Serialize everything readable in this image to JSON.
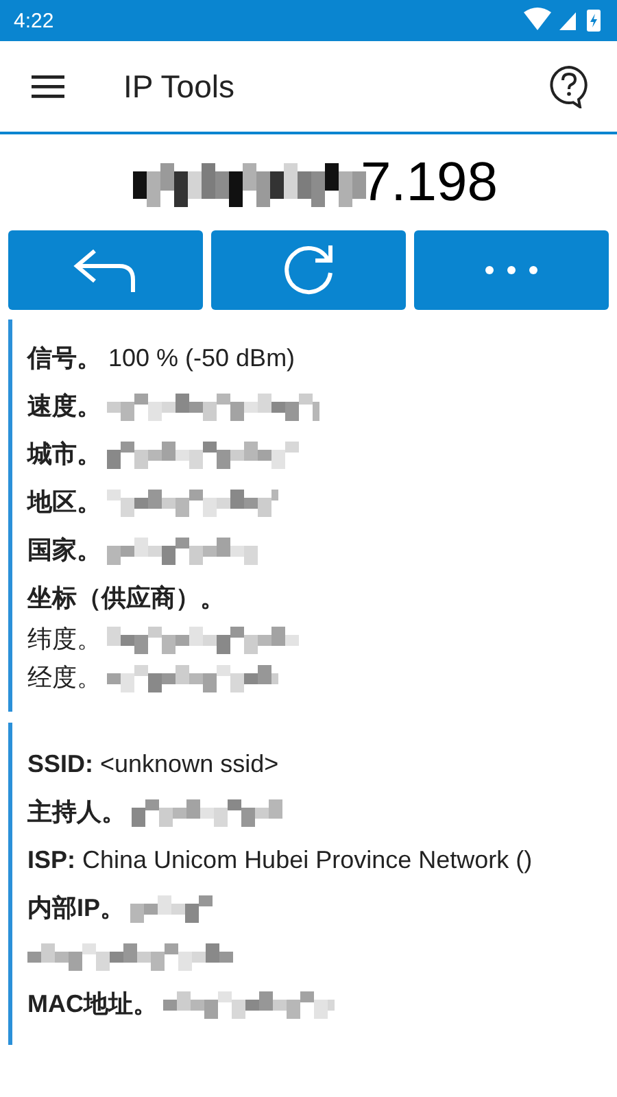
{
  "status_bar": {
    "time": "4:22"
  },
  "app_bar": {
    "title": "IP Tools"
  },
  "ip": {
    "visible_part": "7.198"
  },
  "buttons": [
    {
      "kind": "back"
    },
    {
      "kind": "refresh"
    },
    {
      "kind": "more"
    }
  ],
  "sections": [
    {
      "rows": [
        {
          "kind": "label_value",
          "label": "信号。",
          "value": "100 % (-50 dBm)"
        },
        {
          "kind": "label_blurred",
          "label": "速度。"
        },
        {
          "kind": "label_blurred",
          "label": "城市。"
        },
        {
          "kind": "label_blurred",
          "label": "地区。"
        },
        {
          "kind": "label_blurred",
          "label": "国家。"
        },
        {
          "kind": "heading",
          "label": "坐标（供应商）。"
        },
        {
          "kind": "sub_blurred",
          "label": "纬度。"
        },
        {
          "kind": "sub_blurred",
          "label": "经度。"
        }
      ]
    },
    {
      "rows": [
        {
          "kind": "label_value",
          "label": "SSID:",
          "value": "<unknown ssid>"
        },
        {
          "kind": "label_blurred",
          "label": "主持人。"
        },
        {
          "kind": "label_value",
          "label": "ISP:",
          "value": "China Unicom Hubei Province Network ()"
        },
        {
          "kind": "label_blurred_wrap",
          "label": "内部IP。"
        },
        {
          "kind": "label_blurred",
          "label": "MAC地址。"
        }
      ]
    }
  ]
}
